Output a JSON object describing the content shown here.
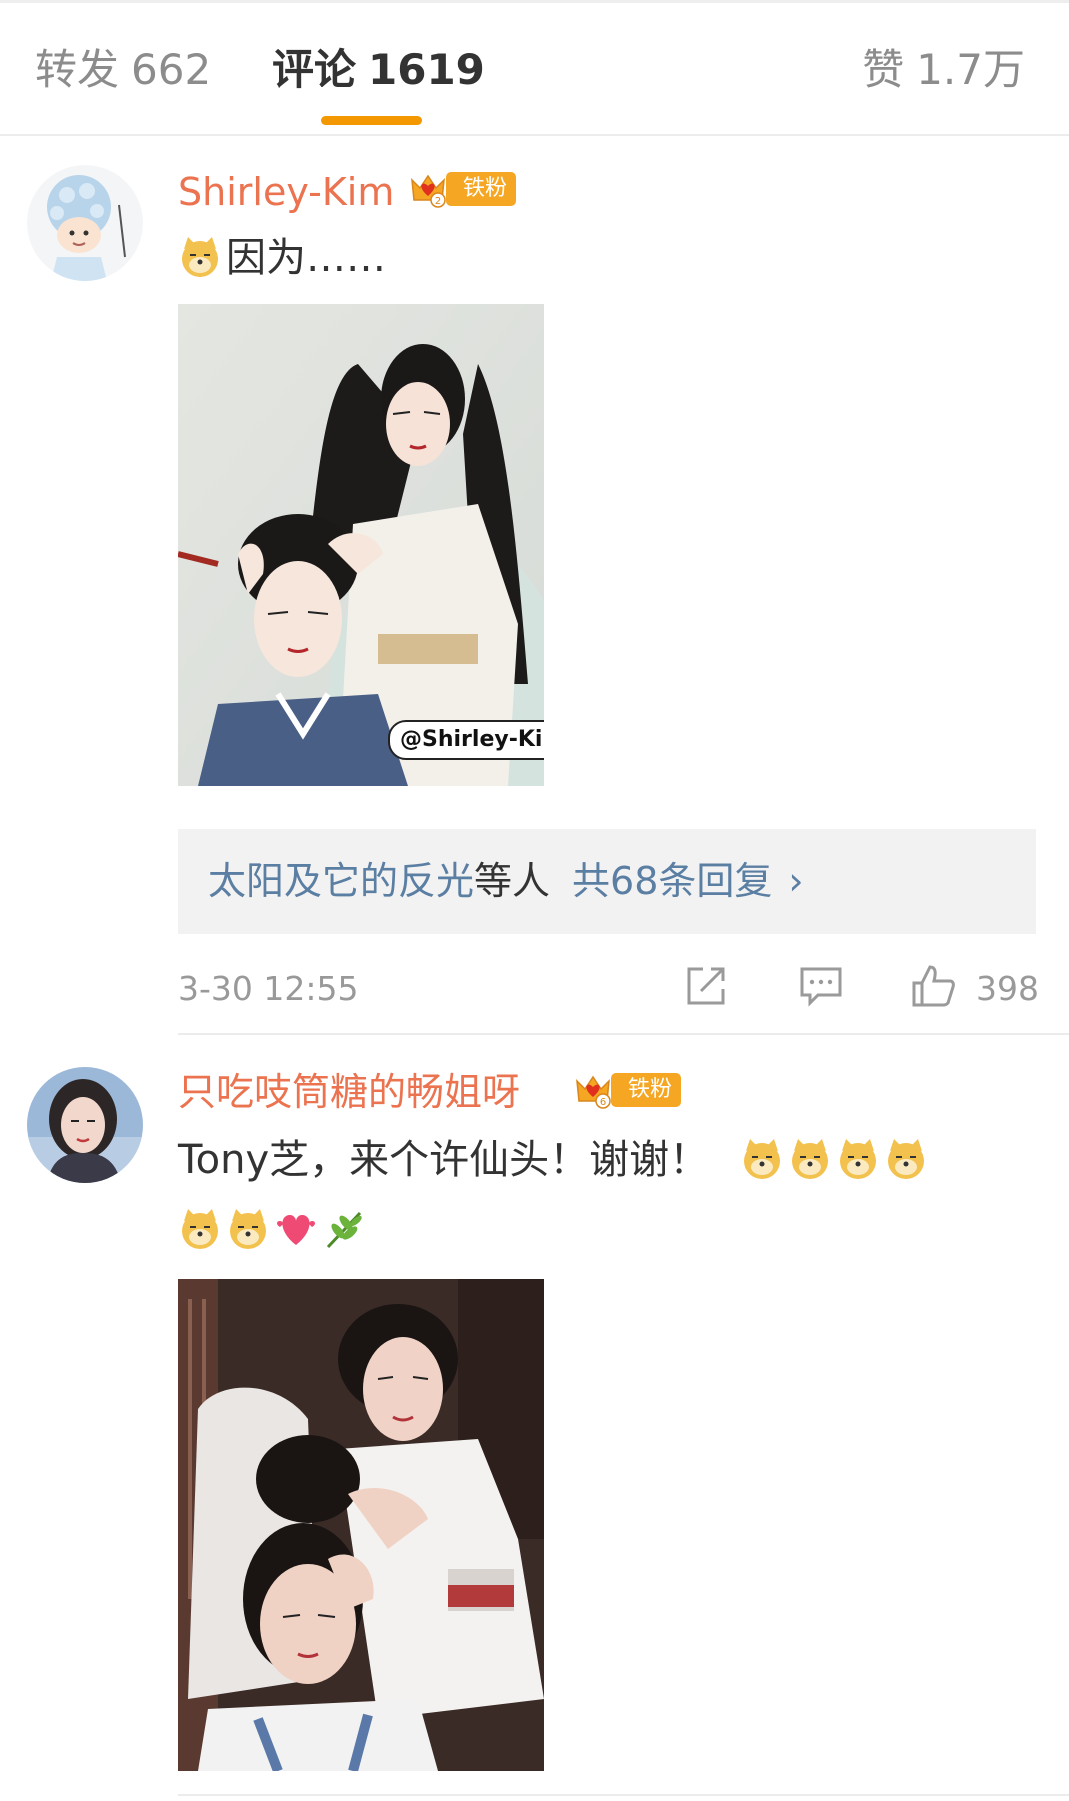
{
  "tabs": {
    "repost": {
      "label": "转发",
      "count": "662"
    },
    "comments": {
      "label": "评论",
      "count": "1619"
    },
    "likes": {
      "label": "赞",
      "count": "1.7万"
    }
  },
  "colors": {
    "accent": "#f39800",
    "username": "#eb7350",
    "link": "#5b7ea3",
    "badge": "#f5a623"
  },
  "comments": [
    {
      "username": "Shirley-Kim",
      "badge": {
        "level": "2",
        "label": "铁粉",
        "icon": "crown-heart-icon"
      },
      "emoji": [
        "doge-emoji"
      ],
      "text": "因为……",
      "image_watermark": "@Shirley-Kim",
      "replies": {
        "names": "太阳及它的反光",
        "suffix": "等人",
        "total": "共68条回复",
        "arrow": "›"
      },
      "timestamp": "3-30 12:55",
      "likes": "398"
    },
    {
      "username": "只吃吱筒糖的畅姐呀",
      "badge": {
        "level": "6",
        "label": "铁粉",
        "icon": "crown-heart-icon"
      },
      "text": "Tony芝，来个许仙头！谢谢！",
      "emoji_line1": [
        "doge-emoji",
        "doge-emoji",
        "doge-emoji",
        "doge-emoji"
      ],
      "emoji_line2": [
        "doge-emoji",
        "doge-emoji",
        "heart-emoji",
        "branch-emoji"
      ]
    }
  ]
}
